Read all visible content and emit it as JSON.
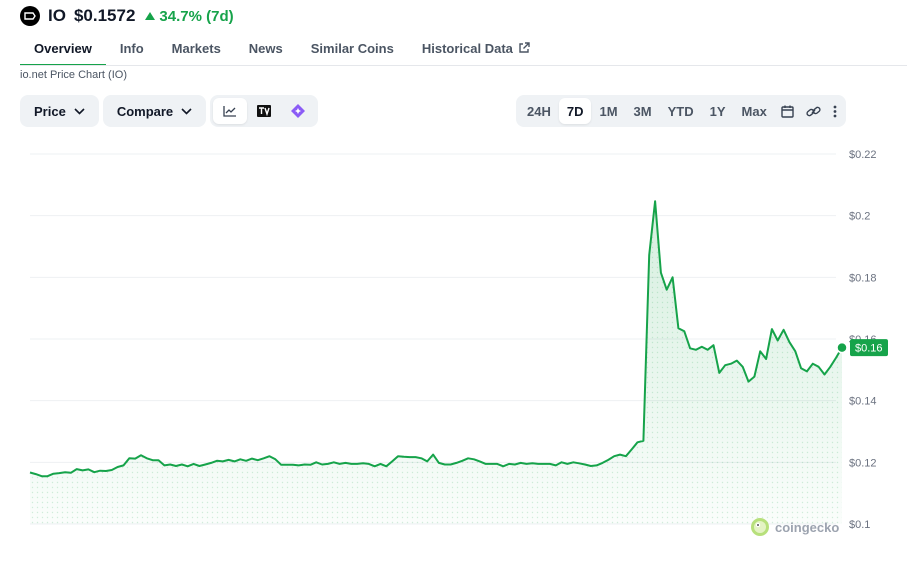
{
  "coin": {
    "symbol": "IO",
    "price": "$0.1572",
    "change": "34.7% (7d)"
  },
  "tabs": [
    {
      "label": "Overview",
      "active": true
    },
    {
      "label": "Info"
    },
    {
      "label": "Markets"
    },
    {
      "label": "News"
    },
    {
      "label": "Similar Coins"
    },
    {
      "label": "Historical Data"
    }
  ],
  "chart_caption": "io.net Price Chart (IO)",
  "toolbar": {
    "price_label": "Price",
    "compare_label": "Compare",
    "ranges": [
      "24H",
      "7D",
      "1M",
      "3M",
      "YTD",
      "1Y",
      "Max"
    ],
    "active_range": "7D"
  },
  "colors": {
    "positive": "#16a34a",
    "line": "#16a34a",
    "grid": "#eef0f3",
    "axis_text": "#6b7280"
  },
  "watermark": "coingecko",
  "chart_data": {
    "type": "area",
    "title": "",
    "xlabel": "",
    "ylabel": "",
    "ylim": [
      0.1,
      0.22
    ],
    "y_ticks": [
      0.22,
      0.2,
      0.18,
      0.16,
      0.14,
      0.12,
      0.1
    ],
    "y_tick_labels": [
      "$0.22",
      "$0.2",
      "$0.18",
      "$0.16",
      "$0.14",
      "$0.12",
      "$0.1"
    ],
    "grid": true,
    "last_label": "$0.16",
    "series": [
      {
        "values": [
          0.1167,
          0.1162,
          0.1155,
          0.1155,
          0.1163,
          0.1165,
          0.1168,
          0.1166,
          0.1178,
          0.1174,
          0.1177,
          0.1168,
          0.1173,
          0.1172,
          0.1175,
          0.1185,
          0.119,
          0.1213,
          0.1212,
          0.1223,
          0.1213,
          0.1207,
          0.1207,
          0.119,
          0.1193,
          0.1188,
          0.1193,
          0.1187,
          0.1195,
          0.1188,
          0.1193,
          0.1198,
          0.1205,
          0.1203,
          0.1208,
          0.1203,
          0.121,
          0.1205,
          0.1212,
          0.1207,
          0.1213,
          0.122,
          0.121,
          0.1192,
          0.1192,
          0.1192,
          0.119,
          0.1193,
          0.1192,
          0.12,
          0.1193,
          0.1195,
          0.12,
          0.1195,
          0.1198,
          0.1195,
          0.1195,
          0.1197,
          0.1195,
          0.1187,
          0.1195,
          0.1187,
          0.1203,
          0.122,
          0.1218,
          0.1217,
          0.1217,
          0.1213,
          0.1203,
          0.1225,
          0.1198,
          0.1193,
          0.1193,
          0.1198,
          0.1205,
          0.1213,
          0.121,
          0.1203,
          0.1195,
          0.1195,
          0.1195,
          0.1187,
          0.1195,
          0.1193,
          0.1198,
          0.1195,
          0.1197,
          0.1195,
          0.1195,
          0.1195,
          0.119,
          0.12,
          0.1195,
          0.12,
          0.1197,
          0.1193,
          0.1188,
          0.119,
          0.1198,
          0.1208,
          0.122,
          0.1225,
          0.122,
          0.1242,
          0.1265,
          0.127,
          0.1872,
          0.2047,
          0.1815,
          0.176,
          0.18,
          0.1635,
          0.1625,
          0.157,
          0.1565,
          0.1575,
          0.1565,
          0.158,
          0.149,
          0.1515,
          0.152,
          0.153,
          0.151,
          0.1462,
          0.1478,
          0.156,
          0.1535,
          0.1632,
          0.1595,
          0.163,
          0.159,
          0.156,
          0.1505,
          0.1495,
          0.152,
          0.151,
          0.1485,
          0.151,
          0.154,
          0.1572
        ]
      }
    ]
  }
}
